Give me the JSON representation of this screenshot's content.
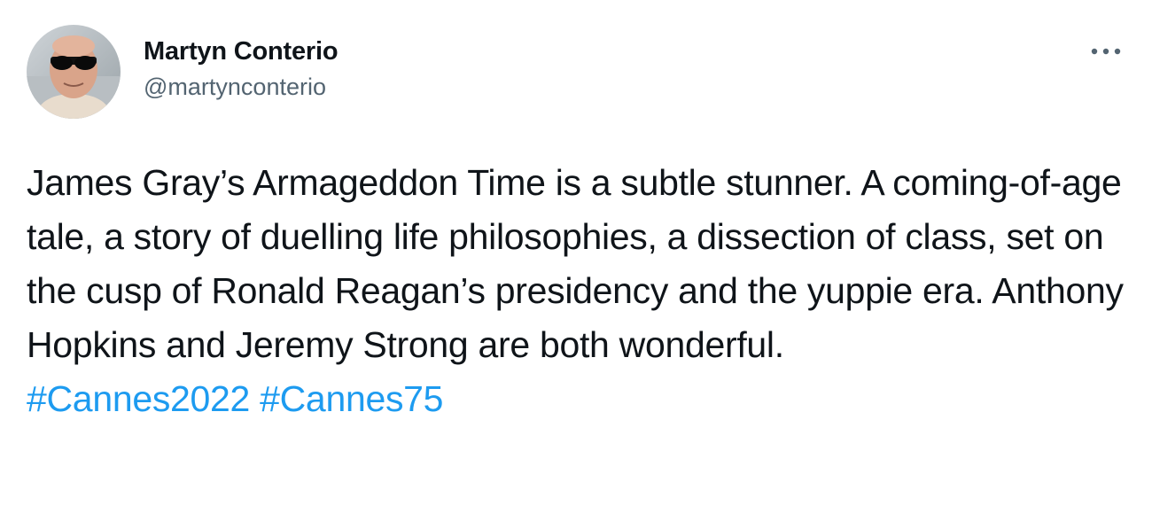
{
  "author": {
    "display_name": "Martyn Conterio",
    "handle": "@martynconterio"
  },
  "tweet": {
    "text": "James Gray’s Armageddon Time is a subtle stunner. A coming-of-age tale, a story of duelling life philosophies, a dissection of class, set on the cusp of Ronald Reagan’s presidency and the yuppie era. Anthony Hopkins and Jeremy Strong are both wonderful.",
    "hashtags": [
      "#Cannes2022",
      "#Cannes75"
    ]
  },
  "icons": {
    "more": "more-options-icon",
    "avatar": "profile-photo"
  },
  "colors": {
    "text": "#0f1419",
    "secondary": "#536471",
    "link": "#1d9bf0",
    "background": "#ffffff"
  }
}
